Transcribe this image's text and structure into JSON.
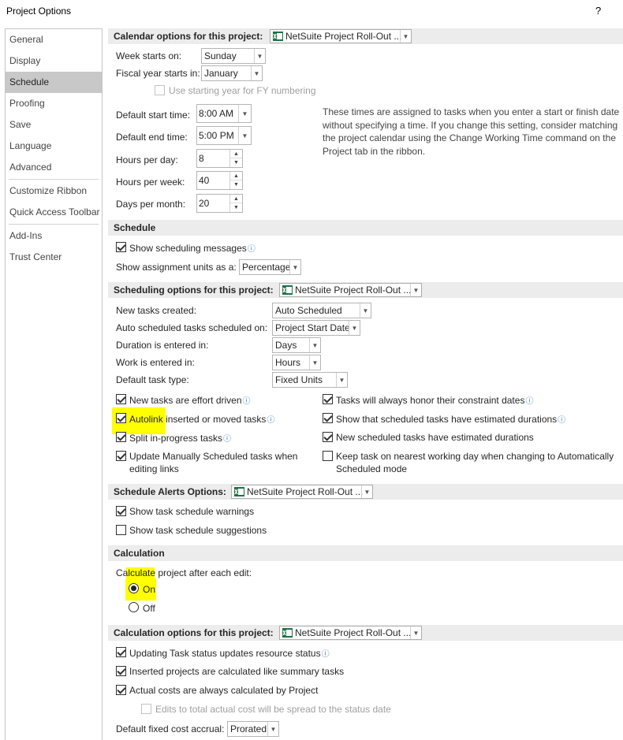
{
  "window": {
    "title": "Project Options",
    "help": "?"
  },
  "nav": {
    "items": [
      "General",
      "Display",
      "Schedule",
      "Proofing",
      "Save",
      "Language",
      "Advanced",
      "Customize Ribbon",
      "Quick Access Toolbar",
      "Add-Ins",
      "Trust Center"
    ],
    "selected": "Schedule"
  },
  "project_name": "NetSuite Project Roll-Out ...",
  "calendar": {
    "header": "Calendar options for this project:",
    "week_starts_label": "Week starts on:",
    "week_starts_value": "Sunday",
    "fiscal_label": "Fiscal year starts in:",
    "fiscal_value": "January",
    "use_fy_label": "Use starting year for FY numbering",
    "default_start_label": "Default start time:",
    "default_start_value": "8:00 AM",
    "default_end_label": "Default end time:",
    "default_end_value": "5:00 PM",
    "hours_day_label": "Hours per day:",
    "hours_day_value": "8",
    "hours_week_label": "Hours per week:",
    "hours_week_value": "40",
    "days_month_label": "Days per month:",
    "days_month_value": "20",
    "description": "These times are assigned to tasks when you enter a start or finish date without specifying a time. If you change this setting, consider matching the project calendar using the Change Working Time command on the Project tab in the ribbon."
  },
  "schedule": {
    "header": "Schedule",
    "show_messages": "Show scheduling messages",
    "assignment_units_label": "Show assignment units as a:",
    "assignment_units_value": "Percentage"
  },
  "scheduling_options": {
    "header": "Scheduling options for this project:",
    "new_tasks_label": "New tasks created:",
    "new_tasks_value": "Auto Scheduled",
    "auto_sched_label": "Auto scheduled tasks scheduled on:",
    "auto_sched_value": "Project Start Date",
    "duration_label": "Duration is entered in:",
    "duration_value": "Days",
    "work_label": "Work is entered in:",
    "work_value": "Hours",
    "task_type_label": "Default task type:",
    "task_type_value": "Fixed Units",
    "effort_driven": "New tasks are effort driven",
    "honor_constraints": "Tasks will always honor their constraint dates",
    "autolink_a": "Autolink",
    "autolink_b": " inserted or moved tasks",
    "show_estimated": "Show that scheduled tasks have estimated durations",
    "split_progress": "Split in-progress tasks",
    "new_estimated": "New scheduled tasks have estimated durations",
    "update_manual_1": "Update Manually Scheduled tasks when",
    "update_manual_2": "editing links",
    "keep_task_1": "Keep task on nearest working day when changing to Automatically",
    "keep_task_2": "Scheduled mode"
  },
  "alerts": {
    "header": "Schedule Alerts Options:",
    "show_warnings": "Show task schedule warnings",
    "show_suggestions": "Show task schedule suggestions"
  },
  "calculation": {
    "header": "Calculation",
    "label_a": "Ca",
    "label_b": "lculate",
    "label_c": " project after each edit:",
    "on": "On",
    "off": "Off"
  },
  "calc_options": {
    "header": "Calculation options for this project:",
    "updating_status": "Updating Task status updates resource status",
    "inserted_projects": "Inserted projects are calculated like summary tasks",
    "actual_costs": "Actual costs are always calculated by Project",
    "edits_total": "Edits to total actual cost will be spread to the status date",
    "fixed_cost_label": "Default fixed cost accrual:",
    "fixed_cost_value": "Prorated"
  },
  "colors": {
    "highlight": "#ffff00",
    "selected_nav": "#c8c8c8",
    "section_bg": "#ececec",
    "excel_green": "#1e7145"
  }
}
